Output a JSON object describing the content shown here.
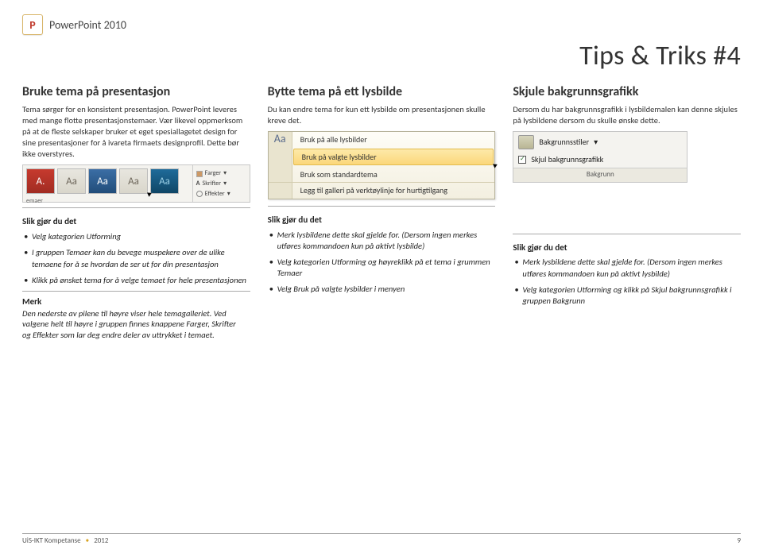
{
  "header": {
    "app": "PowerPoint 2010"
  },
  "page": {
    "title": "Tips & Triks #4"
  },
  "col1": {
    "heading": "Bruke tema på presentasjon",
    "body": "Tema sørger for en konsistent presentasjon. PowerPoint leveres med mange flotte presentasjonstemaer. Vær likevel oppmerksom på at de fleste selskaper bruker et eget spesiallagetet design for sine presentasjoner for å ivareta firmaets designprofil. Dette bør ikke overstyres.",
    "strip": {
      "right": [
        "Farger",
        "Skrifter",
        "Effekter"
      ],
      "label": "emaer"
    },
    "instr_title": "Slik gjør du det",
    "instr": [
      "Velg kategorien Utforming",
      "I gruppen Temaer kan du bevege muspekere over de ulike temaene for å se hvordan de ser ut for din presentasjon",
      "Klikk på ønsket tema for å velge temaet for hele presentasjonen"
    ],
    "merk_title": "Merk",
    "merk_body": "Den nederste av pilene til høyre viser hele temagalleriet. Ved valgene helt til høyre i gruppen finnes knappene Farger, Skrifter og Effekter som lar deg endre deler av uttrykket i temaet."
  },
  "col2": {
    "heading": "Bytte tema på ett lysbilde",
    "body": "Du kan endre tema for kun ett lysbilde om presentasjonen skulle kreve det.",
    "menu": [
      "Bruk på alle lysbilder",
      "Bruk på valgte lysbilder",
      "Bruk som standardtema",
      "Legg til galleri på verktøylinje for hurtigtilgang"
    ],
    "instr_title": "Slik gjør du det",
    "instr": [
      "Merk lysbildene dette skal gjelde for. (Dersom ingen merkes utføres kommandoen kun på aktivt lysbilde)",
      "Velg kategorien Utforming og høyreklikk på et tema i grummen Temaer",
      "Velg Bruk på valgte lysbilder i menyen"
    ]
  },
  "col3": {
    "heading": "Skjule bakgrunnsgrafikk",
    "body": "Dersom du har bakgrunnsgrafikk i lysbildemalen kan denne skjules på lysbildene dersom du skulle ønske dette.",
    "panel": {
      "btn": "Bakgrunnsstiler",
      "chk": "Skjul bakgrunnsgrafikk",
      "group": "Bakgrunn"
    },
    "instr_title": "Slik gjør du det",
    "instr": [
      "Merk lysbildene dette skal gjelde for. (Dersom ingen merkes utføres kommandoen kun på aktivt lysbilde)",
      "Velg kategorien Utforming og klikk på Skjul bakgrunnsgrafikk i gruppen Bakgrunn"
    ]
  },
  "footer": {
    "org": "UiS-IKT Kompetanse",
    "year": "2012",
    "page": "9"
  }
}
